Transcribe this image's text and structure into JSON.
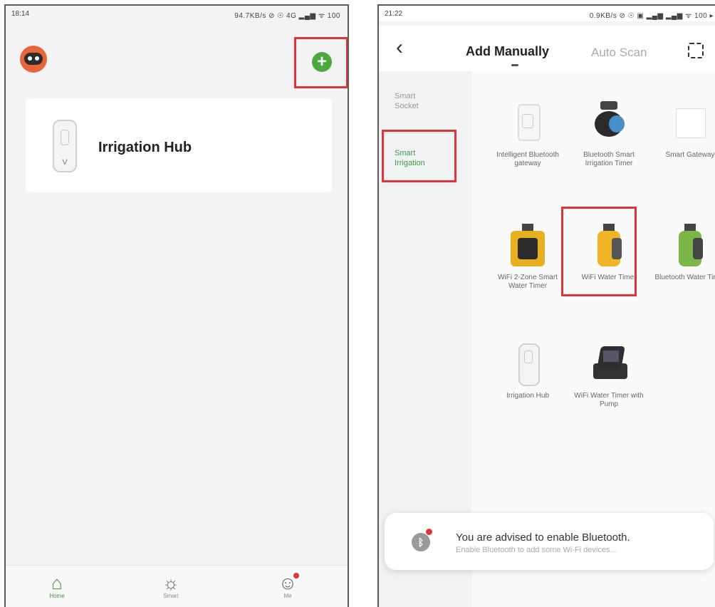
{
  "left_screen": {
    "status_time": "18:14",
    "status_icons": "94.7KB/s ⊘ ☉ 4G ▂▄▆ ᯤ 100",
    "home_item": {
      "name": "Irrigation Hub",
      "device_letter": "V"
    },
    "tabs": [
      {
        "label": "Home",
        "icon": "home-icon"
      },
      {
        "label": "Smart",
        "icon": "sun-icon"
      },
      {
        "label": "Me",
        "icon": "profile-icon"
      }
    ]
  },
  "right_screen": {
    "status_time": "21:22",
    "status_icons": "0.9KB/s ⊘ ☉ ▣ ▂▄▆ ▂▄▆ ᯤ 100 ▸",
    "back_glyph": "‹",
    "tab_add": "Add Manually",
    "tab_auto": "Auto Scan",
    "categories": [
      "Smart Socket",
      "Smart Irrigation"
    ],
    "products": [
      "Intelligent Bluetooth gateway",
      "Bluetooth Smart Irrigation Timer",
      "Smart Gateway",
      "WiFi 2-Zone Smart Water Timer",
      "WiFi Water Timer",
      "Bluetooth Water Timer",
      "Irrigation Hub",
      "WiFi Water Timer with Pump"
    ],
    "toast": {
      "title": "You are advised to enable Bluetooth.",
      "subtitle": "Enable Bluetooth to add some Wi-Fi devices..."
    }
  },
  "colors": {
    "highlight": "#e0343b",
    "accent_green": "#4caa3d"
  }
}
